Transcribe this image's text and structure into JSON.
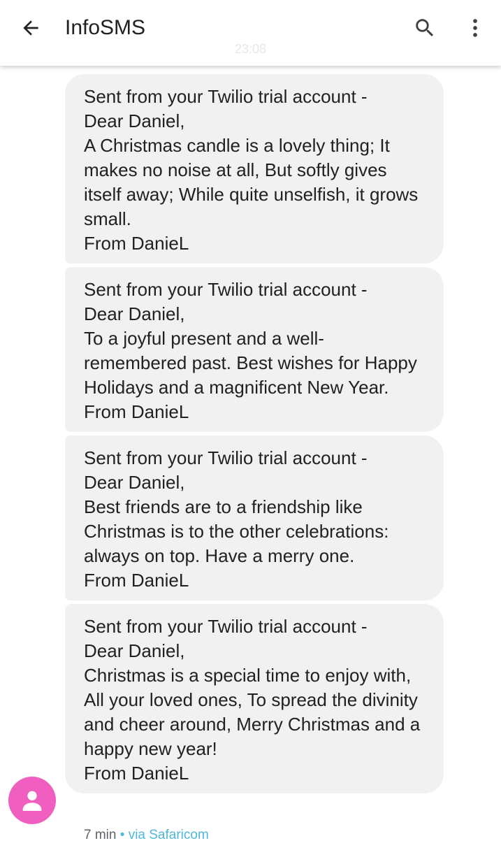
{
  "header": {
    "title": "InfoSMS",
    "back_icon": "arrow-back-icon",
    "search_icon": "search-icon",
    "more_icon": "more-vert-icon"
  },
  "time_divider": "23:08",
  "messages": [
    {
      "lines": [
        "Sent from your Twilio trial account -",
        "Dear Daniel,",
        "A Christmas candle is a lovely thing; It makes no noise at all, But softly gives itself away; While quite unselfish, it grows small.",
        "From DanieL"
      ]
    },
    {
      "lines": [
        "Sent from your Twilio trial account -",
        "Dear Daniel,",
        "To a joyful present and a well-remembered past. Best wishes for Happy Holidays and a magnificent New Year.",
        "From DanieL"
      ]
    },
    {
      "lines": [
        "Sent from your Twilio trial account -",
        "Dear Daniel,",
        "Best friends are to a friendship like Christmas is to the other celebrations: always on top. Have a merry one.",
        "From DanieL"
      ]
    },
    {
      "lines": [
        "Sent from your Twilio trial account -",
        "Dear Daniel,",
        "Christmas is a special time to enjoy with, All your loved ones, To spread the divinity and cheer around, Merry Christmas and a happy new year!",
        "From DanieL"
      ]
    }
  ],
  "footer": {
    "time": "7 min",
    "separator": "•",
    "via": "via Safaricom"
  },
  "colors": {
    "bubble": "#f1f1f1",
    "avatar": "#f05fbf",
    "link": "#4fb8d8"
  }
}
